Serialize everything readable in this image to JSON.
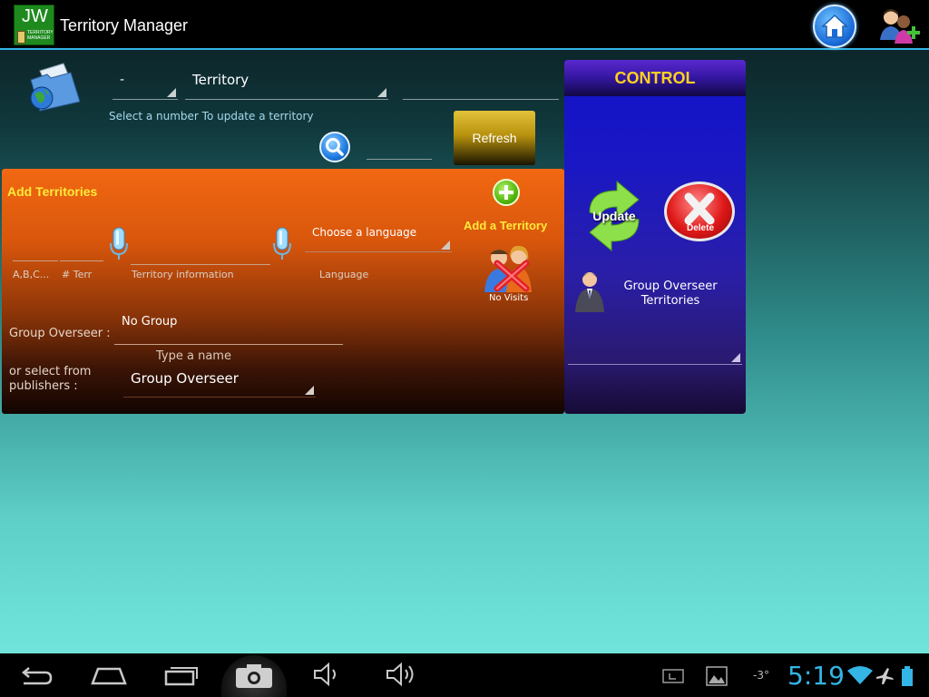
{
  "app": {
    "logo_text": "JW",
    "logo_subtext_1": "TERRITORY",
    "logo_subtext_2": "MANAGER",
    "title": "Territory Manager"
  },
  "search": {
    "number_value": "-",
    "territory_value": "Territory",
    "territory_text_value": "",
    "hint": "Select a number To update a territory",
    "search_value": "",
    "refresh_label": "Refresh"
  },
  "add_panel": {
    "title": "Add Territories",
    "abc_value": "",
    "abc_label": "A,B,C...",
    "terr_num_value": "",
    "terr_num_label": "# Terr",
    "territory_info_value": "",
    "territory_info_label": "Territory information",
    "language_value": "Choose a language",
    "language_label": "Language",
    "add_territory_label": "Add a Territory",
    "no_visits_label": "No Visits",
    "group_overseer_label": "Group Overseer :",
    "group_overseer_value": "No Group",
    "type_name_hint": "Type a name",
    "select_from_label": "or select from publishers :",
    "publisher_spinner_value": "Group Overseer"
  },
  "control": {
    "title": "CONTROL",
    "update_label": "Update",
    "delete_label": "Delete",
    "go_territories_label": "Group Overseer Territories",
    "spinner_value": ""
  },
  "systembar": {
    "temperature": "-3°",
    "clock": "5:19"
  },
  "colors": {
    "accent": "#33b5e5",
    "title_yellow": "#ffeb3b",
    "control_blue": "#1a18c4",
    "panel_orange": "#f26812"
  },
  "icons": [
    "home-icon",
    "add-person-icon",
    "folder-globe-icon",
    "search-icon",
    "microphone-icon",
    "add-icon",
    "no-visits-icon",
    "update-icon",
    "delete-icon",
    "overseer-avatar",
    "back-icon",
    "home-nav-icon",
    "recent-apps-icon",
    "camera-icon",
    "volume-down-icon",
    "volume-up-icon",
    "keyboard-icon",
    "gallery-icon",
    "wifi-icon",
    "airplane-icon",
    "battery-icon"
  ]
}
